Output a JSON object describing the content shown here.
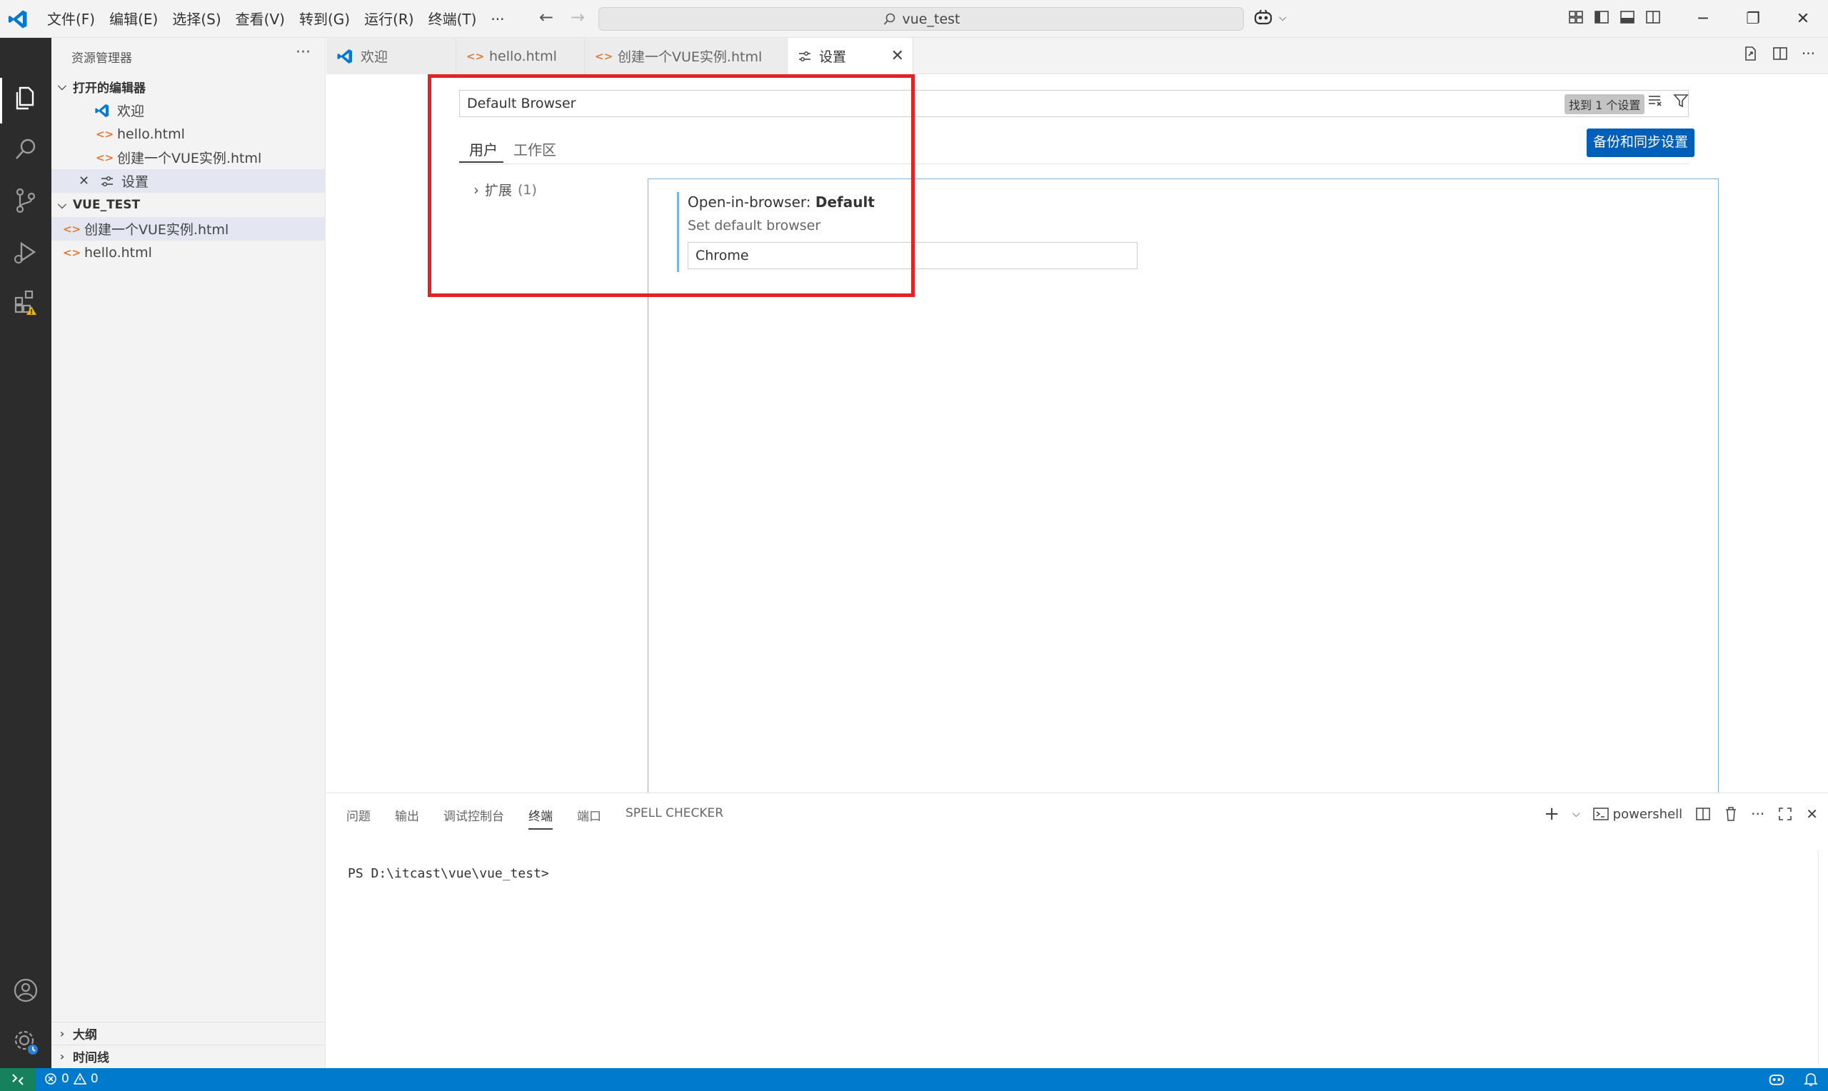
{
  "titlebar": {
    "menu": [
      "文件(F)",
      "编辑(E)",
      "选择(S)",
      "查看(V)",
      "转到(G)",
      "运行(R)",
      "终端(T)",
      "···"
    ],
    "search_text": "vue_test"
  },
  "sidebar": {
    "title": "资源管理器",
    "open_editors_label": "打开的编辑器",
    "open_editors": [
      {
        "label": "欢迎"
      },
      {
        "label": "hello.html"
      },
      {
        "label": "创建一个VUE实例.html"
      },
      {
        "label": "设置"
      }
    ],
    "workspace_label": "VUE_TEST",
    "files": [
      {
        "label": "创建一个VUE实例.html"
      },
      {
        "label": "hello.html"
      }
    ],
    "outline_label": "大纲",
    "timeline_label": "时间线"
  },
  "tabs": [
    {
      "label": "欢迎"
    },
    {
      "label": "hello.html"
    },
    {
      "label": "创建一个VUE实例.html"
    },
    {
      "label": "设置"
    }
  ],
  "settings": {
    "search_value": "Default Browser",
    "result_count": "找到 1 个设置",
    "scope_user": "用户",
    "scope_workspace": "工作区",
    "sync_button": "备份和同步设置",
    "toc_label": "扩展",
    "toc_count": "(1)",
    "setting_prefix": "Open-in-browser: ",
    "setting_name": "Default",
    "setting_desc": "Set default browser",
    "setting_value": "Chrome"
  },
  "panel": {
    "tabs": [
      "问题",
      "输出",
      "调试控制台",
      "终端",
      "端口",
      "SPELL CHECKER"
    ],
    "active_tab": "终端",
    "shell": "powershell",
    "terminal_line": "PS D:\\itcast\\vue\\vue_test>"
  },
  "statusbar": {
    "errors": "0",
    "warnings": "0"
  },
  "colors": {
    "accent": "#005fb8",
    "statusbar": "#007acc",
    "highlight": "#e32226"
  }
}
